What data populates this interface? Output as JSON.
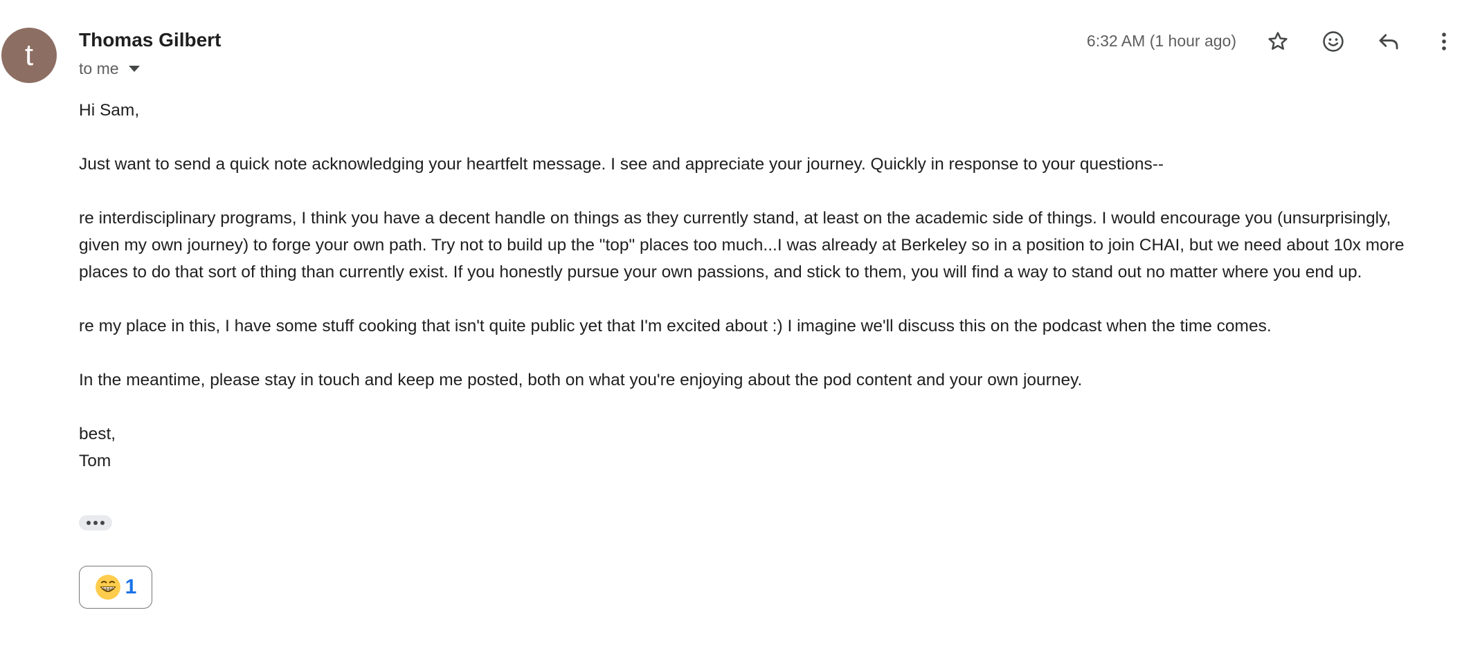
{
  "sender": {
    "avatar_letter": "t",
    "avatar_color": "#8d6e63",
    "name": "Thomas Gilbert"
  },
  "recipient": {
    "label": "to me"
  },
  "timestamp": "6:32 AM (1 hour ago)",
  "toolbar": {
    "icons": [
      "star-icon",
      "emoji-icon",
      "reply-icon",
      "more-vert-icon"
    ]
  },
  "body": {
    "greeting": "Hi Sam,",
    "paragraphs": [
      "Just want to send a quick note acknowledging your heartfelt message. I see and appreciate your journey. Quickly in response to your questions--",
      "re interdisciplinary programs, I think you have a decent handle on things as they currently stand, at least on the academic side of things. I would encourage you (unsurprisingly, given my own journey) to forge your own path. Try not to build up the \"top\" places too much...I was already at Berkeley so in a position to join CHAI, but we need about 10x more places to do that sort of thing than currently exist. If you honestly pursue your own passions, and stick to them, you will find a way to stand out no matter where you end up.",
      "re my place in this, I have some stuff cooking that isn't quite public yet that I'm excited about :) I imagine we'll discuss this on the podcast when the time comes.",
      "In the meantime, please stay in touch and keep me posted, both on what you're enjoying about the pod content and your own journey."
    ],
    "signoff": "best,",
    "signature": "Tom"
  },
  "reaction": {
    "emoji": "grinning-face-icon",
    "count": "1",
    "count_color": "#1a73e8"
  }
}
